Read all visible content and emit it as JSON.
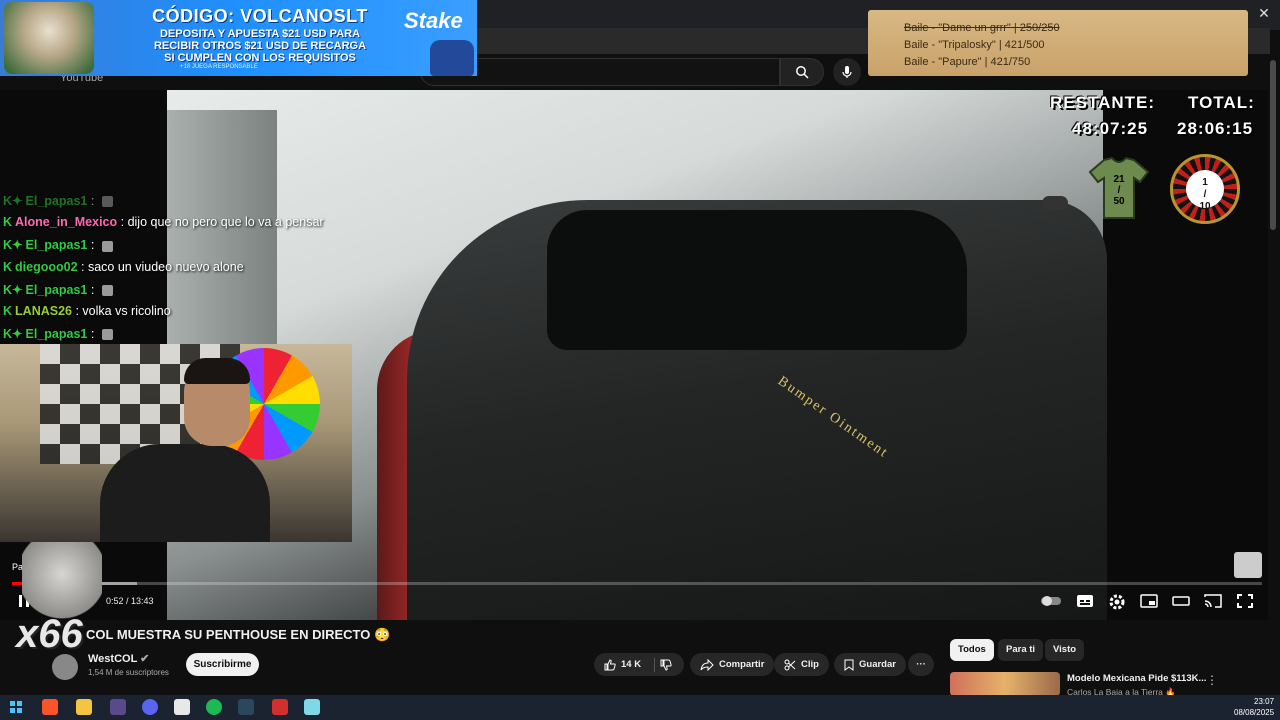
{
  "window": {
    "close_glyph": "✕"
  },
  "banner": {
    "line1": "CÓDIGO: VOLCANOSLT",
    "line2": "DEPOSITA Y APUESTA $21 USD PARA",
    "line3": "RECIBIR OTROS $21 USD DE RECARGA",
    "line4": "SI CUMPLEN CON LOS REQUISITOS",
    "line5": "+18 JUEGA RESPONSABLE",
    "brand": "Stake"
  },
  "youtube": {
    "logo_fragment": "YouTube"
  },
  "search": {
    "placeholder": ""
  },
  "parchment": {
    "lines": [
      "Baile - \"Dame un grrr\" | 250/250",
      "Baile - \"Tripalosky\" | 421/500",
      "Baile - \"Papure\" | 421/750"
    ]
  },
  "overlay": {
    "restante_label": "RESTANTE:",
    "restante_value": "48:07:25",
    "total_label": "TOTAL:",
    "total_value": "28:06:15",
    "shirt_count": "21",
    "shirt_total": "50",
    "roulette_count": "1",
    "roulette_total": "10"
  },
  "video": {
    "hood_text": "Bumper Ointment"
  },
  "chat": [
    {
      "user": "El_papas1",
      "color": "#2ecc40",
      "msg": "",
      "badge": "K✦",
      "emote": true
    },
    {
      "user": "Alone_in_Mexico",
      "color": "#ff69b4",
      "msg": "dijo que no pero que lo va a pensar",
      "badge": "K",
      "emote": false
    },
    {
      "user": "El_papas1",
      "color": "#2ecc40",
      "msg": "",
      "badge": "K✦",
      "emote": true
    },
    {
      "user": "diegooo02",
      "color": "#2ecc40",
      "msg": "saco un viudeo nuevo alone",
      "badge": "K",
      "emote": false
    },
    {
      "user": "El_papas1",
      "color": "#2ecc40",
      "msg": "",
      "badge": "K✦",
      "emote": true
    },
    {
      "user": "LANAS26",
      "color": "#9acd32",
      "msg": "volka vs ricolino",
      "badge": "K",
      "emote": false
    },
    {
      "user": "El_papas1",
      "color": "#2ecc40",
      "msg": "",
      "badge": "K✦",
      "emote": true
    }
  ],
  "player": {
    "paused_tooltip": "Pausa",
    "current_time": "0:52",
    "duration": "13:43",
    "time_display": "0:52 / 13:43",
    "progress_fraction": 0.063,
    "buffer_fraction": 0.1,
    "combo_text": "x66"
  },
  "video_info": {
    "title": "COL MUESTRA SU PENTHOUSE EN DIRECTO 😳",
    "channel": "WestCOL",
    "subscribers": "1,54 M de suscriptores",
    "subscribe_label": "Suscribirme",
    "likes": "14 K",
    "share_label": "Compartir",
    "clip_label": "Clip",
    "save_label": "Guardar",
    "more_label": "···"
  },
  "recommendations": {
    "chips": [
      "Todos",
      "Para ti",
      "Visto"
    ],
    "first": {
      "title": "Modelo Mexicana Pide $113K...",
      "channel": "Carlos La Baja a la Tierra 🔥"
    }
  },
  "taskbar": {
    "time": "23:07",
    "date": "08/08/2025"
  },
  "colors": {
    "accent": "#ff0000",
    "chat_badge": "#2ecc40",
    "parchment": "#d8b884"
  }
}
